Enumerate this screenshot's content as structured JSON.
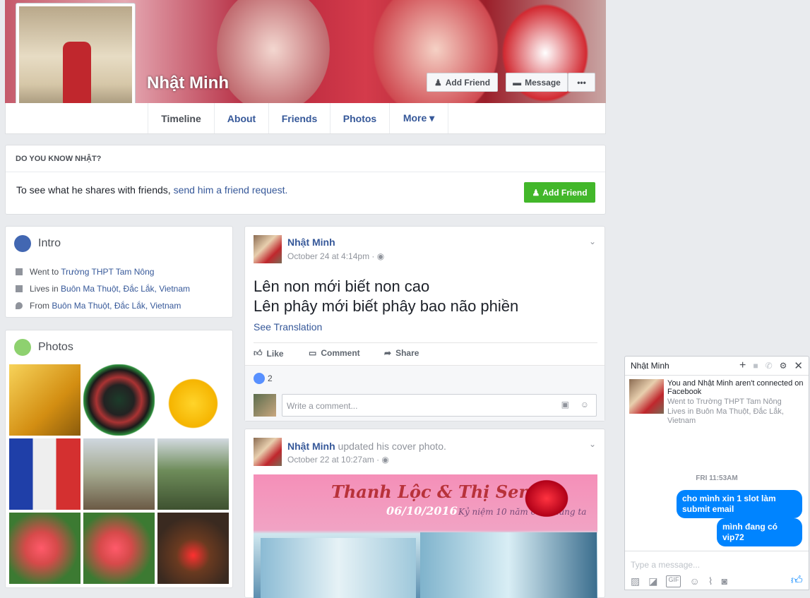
{
  "profile": {
    "name": "Nhật Minh"
  },
  "cover_buttons": {
    "add_friend": "Add Friend",
    "message": "Message",
    "more": "•••"
  },
  "nav": {
    "tabs": [
      {
        "label": "Timeline"
      },
      {
        "label": "About"
      },
      {
        "label": "Friends"
      },
      {
        "label": "Photos"
      },
      {
        "label": "More ▾"
      }
    ]
  },
  "know": {
    "title": "DO YOU KNOW NHẬT?",
    "text": "To see what he shares with friends, ",
    "link": "send him a friend request.",
    "button": "Add Friend"
  },
  "intro": {
    "title": "Intro",
    "items": [
      {
        "prefix": "Went to ",
        "link": "Trường THPT Tam Nông"
      },
      {
        "prefix": "Lives in ",
        "link": "Buôn Ma Thuột, Đắc Lắk, Vietnam"
      },
      {
        "prefix": "From ",
        "link": "Buôn Ma Thuột, Đắc Lắk, Vietnam"
      }
    ]
  },
  "photos": {
    "title": "Photos"
  },
  "post1": {
    "author": "Nhật Minh",
    "time": "October 24 at 4:14pm · ",
    "line1": "Lên non mới biết non cao",
    "line2": "Lên phây mới biết phây bao não phiền",
    "see_translation": "See Translation",
    "like": "Like",
    "comment": "Comment",
    "share": "Share",
    "likes_count": "2",
    "comment_placeholder": "Write a comment..."
  },
  "post2": {
    "author": "Nhật Minh",
    "action": " updated his cover photo.",
    "time": "October 22 at 10:27am · ",
    "banner_title": "Thanh Lộc & Thị Sen",
    "banner_date": "06/10/2016",
    "banner_sub": "Kỷ niệm 10 năm của chúng ta"
  },
  "chat": {
    "title": "Nhật Minh",
    "notice": "You and Nhật Minh aren't connected on Facebook",
    "school": "Went to Trường THPT Tam Nông",
    "lives": "Lives in Buôn Ma Thuột, Đắc Lắk, Vietnam",
    "timestamp": "FRI 11:53AM",
    "messages": [
      "cho mình xin 1 slot làm submit email",
      "mình đang có vip72"
    ],
    "input_placeholder": "Type a message..."
  }
}
